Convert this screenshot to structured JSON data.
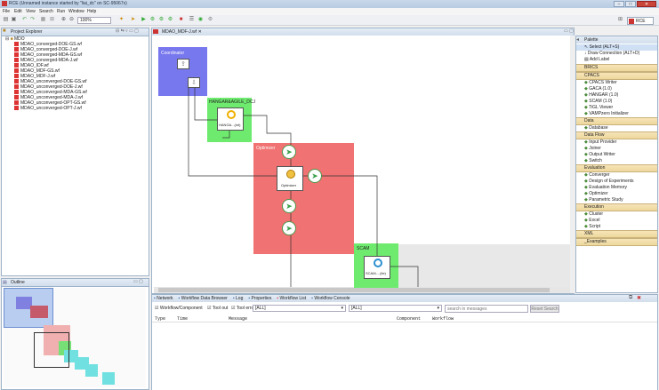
{
  "window": {
    "title": "RCE (Unnamed instance started by \"liai_dc\" on SC-95067x)",
    "minimize": "–",
    "maximize": "□",
    "close": "✕"
  },
  "menu": [
    "File",
    "Edit",
    "View",
    "Search",
    "Run",
    "Window",
    "Help"
  ],
  "toolbar": {
    "zoom_value": "100%",
    "perspective_label": "RCE"
  },
  "project_explorer": {
    "tab_label": "Project Explorer",
    "folder": "MDO",
    "files": [
      "MDAO_converged-DOE-GS.wf",
      "MDAO_converged-DOE-J.wf",
      "MDAO_converged-MDA-GS.wf",
      "MDAO_converged-MDA-J.wf",
      "MDAO_IDF.wf",
      "MDAO_MDF-GS.wf",
      "MDAO_MDF-J.wf",
      "MDAO_unconverged-DOE-GS.wf",
      "MDAO_unconverged-DOE-J.wf",
      "MDAO_unconverged-MDA-GS.wf",
      "MDAO_unconverged-MDA-J.wf",
      "MDAO_unconverged-OPT-GS.wf",
      "MDAO_unconverged-OPT-J.wf"
    ]
  },
  "outline": {
    "tab_label": "Outline"
  },
  "editor": {
    "tab_label": "MDAO_MDF-J.wf",
    "groups": {
      "coordinator": "Coordinator",
      "hangar": "HANGAR&AGILE_DCJ",
      "optimizer": "Optimizer",
      "scam": "SCAM"
    },
    "components": {
      "hangar_label": "HANGA...(int)",
      "optimizer_label": "Optimizer",
      "scam_label": "SCAM-...(ile)"
    }
  },
  "palette": {
    "title": "Palette",
    "tools": [
      "Select (ALT+S)",
      "Draw Connection (ALT+D)",
      "Add Label"
    ],
    "groups": [
      {
        "name": "BRICS",
        "items": []
      },
      {
        "name": "CPACS",
        "items": [
          "CPACS Writer",
          "GACA (1.0)",
          "HANGAR (1.0)",
          "SCAM (1.0)",
          "TiGL Viewer",
          "VAMPzero Initializer"
        ]
      },
      {
        "name": "Data",
        "items": [
          "Database"
        ]
      },
      {
        "name": "Data Flow",
        "items": [
          "Input Provider",
          "Joiner",
          "Output Writer",
          "Switch"
        ]
      },
      {
        "name": "Evaluation",
        "items": [
          "Converger",
          "Design of Experiments",
          "Evaluation Memory",
          "Optimizer",
          "Parametric Study"
        ]
      },
      {
        "name": "Execution",
        "items": [
          "Cluster",
          "Excel",
          "Script"
        ]
      },
      {
        "name": "XML",
        "items": []
      },
      {
        "name": "_Examples",
        "items": []
      }
    ]
  },
  "console": {
    "tabs": [
      "Network",
      "Workflow Data Browser",
      "Log",
      "Properties",
      "Workflow List",
      "Workflow Console"
    ],
    "filters": {
      "workflow_component": "Workflow/Component",
      "tool_out": "Tool out",
      "tool_error": "Tool error",
      "component_value": "[ALL]",
      "workflow_value": "[ALL]",
      "search_placeholder": "search in messages",
      "reset_label": "Reset Search"
    },
    "columns": [
      "Type",
      "Time",
      "Message",
      "Component",
      "Workflow"
    ]
  }
}
